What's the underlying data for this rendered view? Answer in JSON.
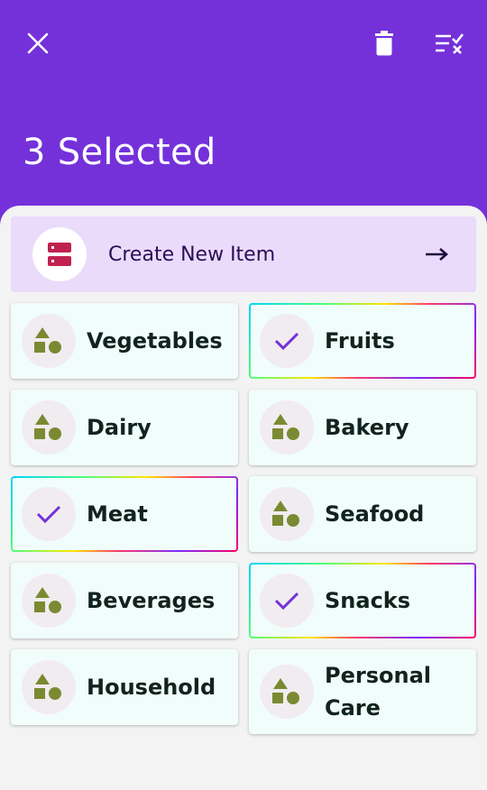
{
  "header": {
    "title": "3 Selected",
    "close_icon": "close-icon",
    "delete_icon": "trash-icon",
    "deselect_icon": "deselect-all-icon",
    "background": "#7431d9"
  },
  "create_item": {
    "label": "Create New Item",
    "icon": "storage-icon",
    "arrow_icon": "arrow-right-icon",
    "background": "#eadbfb",
    "icon_color": "#c0224f"
  },
  "categories": [
    {
      "label": "Vegetables",
      "selected": false
    },
    {
      "label": "Fruits",
      "selected": true
    },
    {
      "label": "Dairy",
      "selected": false
    },
    {
      "label": "Bakery",
      "selected": false
    },
    {
      "label": "Meat",
      "selected": true
    },
    {
      "label": "Seafood",
      "selected": false
    },
    {
      "label": "Beverages",
      "selected": false
    },
    {
      "label": "Snacks",
      "selected": true
    },
    {
      "label": "Household",
      "selected": false
    },
    {
      "label": "Personal Care",
      "selected": false
    }
  ],
  "colors": {
    "category_icon": "#7a8a32",
    "check": "#7431d9",
    "card_bg": "#f1fdfa"
  }
}
